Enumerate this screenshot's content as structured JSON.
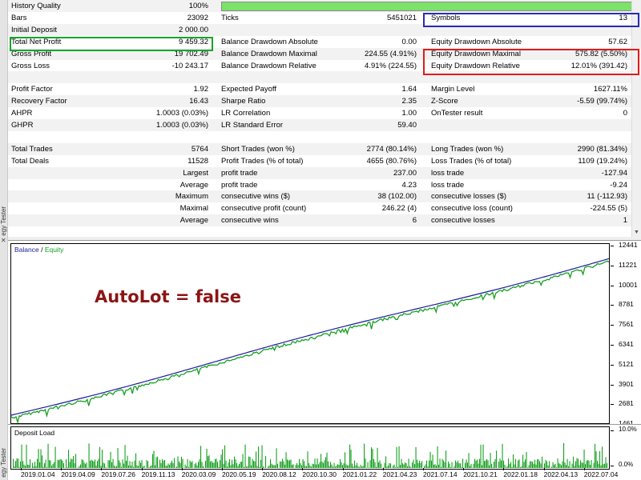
{
  "report": {
    "rows": [
      {
        "a_label": "History Quality",
        "a_value": "100%",
        "b_label": "",
        "b_value": "",
        "c_label": "",
        "c_value": "",
        "alt": true,
        "quality_bar": true
      },
      {
        "a_label": "Bars",
        "a_value": "23092",
        "b_label": "Ticks",
        "b_value": "5451021",
        "c_label": "Symbols",
        "c_value": "13",
        "alt": false
      },
      {
        "a_label": "Initial Deposit",
        "a_value": "2 000.00",
        "b_label": "",
        "b_value": "",
        "c_label": "",
        "c_value": "",
        "alt": true
      },
      {
        "a_label": "Total Net Profit",
        "a_value": "9 459.32",
        "b_label": "Balance Drawdown Absolute",
        "b_value": "0.00",
        "c_label": "Equity Drawdown Absolute",
        "c_value": "57.62",
        "alt": false
      },
      {
        "a_label": "Gross Profit",
        "a_value": "19 702.49",
        "b_label": "Balance Drawdown Maximal",
        "b_value": "224.55 (4.91%)",
        "c_label": "Equity Drawdown Maximal",
        "c_value": "575.82 (5.50%)",
        "alt": true
      },
      {
        "a_label": "Gross Loss",
        "a_value": "-10 243.17",
        "b_label": "Balance Drawdown Relative",
        "b_value": "4.91% (224.55)",
        "c_label": "Equity Drawdown Relative",
        "c_value": "12.01% (391.42)",
        "alt": false
      },
      {
        "a_label": "",
        "a_value": "",
        "b_label": "",
        "b_value": "",
        "c_label": "",
        "c_value": "",
        "alt": true
      },
      {
        "a_label": "Profit Factor",
        "a_value": "1.92",
        "b_label": "Expected Payoff",
        "b_value": "1.64",
        "c_label": "Margin Level",
        "c_value": "1627.11%",
        "alt": false
      },
      {
        "a_label": "Recovery Factor",
        "a_value": "16.43",
        "b_label": "Sharpe Ratio",
        "b_value": "2.35",
        "c_label": "Z-Score",
        "c_value": "-5.59 (99.74%)",
        "alt": true
      },
      {
        "a_label": "AHPR",
        "a_value": "1.0003 (0.03%)",
        "b_label": "LR Correlation",
        "b_value": "1.00",
        "c_label": "OnTester result",
        "c_value": "0",
        "alt": false
      },
      {
        "a_label": "GHPR",
        "a_value": "1.0003 (0.03%)",
        "b_label": "LR Standard Error",
        "b_value": "59.40",
        "c_label": "",
        "c_value": "",
        "alt": true
      },
      {
        "a_label": "",
        "a_value": "",
        "b_label": "",
        "b_value": "",
        "c_label": "",
        "c_value": "",
        "alt": false
      },
      {
        "a_label": "Total Trades",
        "a_value": "5764",
        "b_label": "Short Trades (won %)",
        "b_value": "2774 (80.14%)",
        "c_label": "Long Trades (won %)",
        "c_value": "2990 (81.34%)",
        "alt": true
      },
      {
        "a_label": "Total Deals",
        "a_value": "11528",
        "b_label": "Profit Trades (% of total)",
        "b_value": "4655 (80.76%)",
        "c_label": "Loss Trades (% of total)",
        "c_value": "1109 (19.24%)",
        "alt": false
      },
      {
        "a_label": "",
        "a_value": "Largest",
        "b_label": "profit trade",
        "b_value": "237.00",
        "c_label": "loss trade",
        "c_value": "-127.94",
        "alt": true
      },
      {
        "a_label": "",
        "a_value": "Average",
        "b_label": "profit trade",
        "b_value": "4.23",
        "c_label": "loss trade",
        "c_value": "-9.24",
        "alt": false
      },
      {
        "a_label": "",
        "a_value": "Maximum",
        "b_label": "consecutive wins ($)",
        "b_value": "38 (102.00)",
        "c_label": "consecutive losses ($)",
        "c_value": "11 (-112.93)",
        "alt": true
      },
      {
        "a_label": "",
        "a_value": "Maximal",
        "b_label": "consecutive profit (count)",
        "b_value": "246.22 (4)",
        "c_label": "consecutive loss (count)",
        "c_value": "-224.55 (5)",
        "alt": false
      },
      {
        "a_label": "",
        "a_value": "Average",
        "b_label": "consecutive wins",
        "b_value": "6",
        "c_label": "consecutive losses",
        "c_value": "1",
        "alt": true
      }
    ]
  },
  "side_labels": {
    "top": "egy Tester",
    "bottom": "egy Tester"
  },
  "graph": {
    "legend_balance": "Balance",
    "legend_sep": " / ",
    "legend_equity": "Equity",
    "annotation": "AutoLot = false",
    "y_ticks": [
      "12441",
      "11221",
      "10001",
      "8781",
      "7561",
      "6341",
      "5121",
      "3901",
      "2681",
      "1461"
    ],
    "balance_color": "#1c1c9e",
    "equity_color": "#15a01f"
  },
  "deposit_load": {
    "title": "Deposit Load",
    "y_top": "10.0%",
    "y_bottom": "0.0%"
  },
  "x_ticks": [
    "2019.01.04",
    "2019.04.09",
    "2019.07.26",
    "2019.11.13",
    "2020.03.09",
    "2020.05.19",
    "2020.08.12",
    "2020.10.30",
    "2021.01.22",
    "2021.04.23",
    "2021.07.14",
    "2021.10.21",
    "2022.01.18",
    "2022.04.13",
    "2022.07.04"
  ],
  "highlight_colors": {
    "green": "#16a52b",
    "blue": "#2b2bb4",
    "red": "#e21b1b"
  }
}
